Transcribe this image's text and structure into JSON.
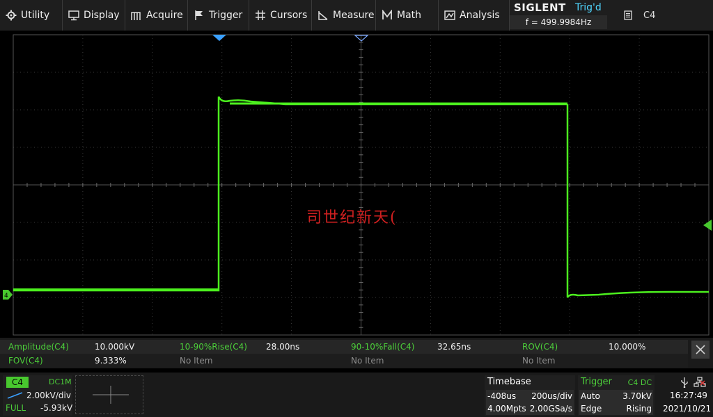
{
  "menu": {
    "utility": "Utility",
    "display": "Display",
    "acquire": "Acquire",
    "trigger": "Trigger",
    "cursors": "Cursors",
    "measure": "Measure",
    "math": "Math",
    "analysis": "Analysis"
  },
  "header": {
    "brand": "SIGLENT",
    "trig_state": "Trig'd",
    "frequency": "f = 499.9984Hz",
    "channel_select": "C4"
  },
  "watermark": "司世纪新天(",
  "measurements": {
    "row1": [
      {
        "label": "Amplitude(C4)",
        "value": "10.000kV"
      },
      {
        "label": "10-90%Rise(C4)",
        "value": "28.00ns"
      },
      {
        "label": "90-10%Fall(C4)",
        "value": "32.65ns"
      },
      {
        "label": "ROV(C4)",
        "value": "10.000%"
      }
    ],
    "row2": [
      {
        "label": "FOV(C4)",
        "value": "9.333%"
      },
      {
        "label": "No Item",
        "value": ""
      },
      {
        "label": "No Item",
        "value": ""
      },
      {
        "label": "No Item",
        "value": ""
      }
    ]
  },
  "channel": {
    "name": "C4",
    "coupling": "DC1M",
    "scale": "2.00kV/div",
    "bandwidth": "FULL",
    "offset": "-5.93kV",
    "color": "#48c82e"
  },
  "timebase": {
    "title": "Timebase",
    "delay": "-408us",
    "scale": "200us/div",
    "memory": "4.00Mpts",
    "sample_rate": "2.00GSa/s"
  },
  "trigger": {
    "title": "Trigger",
    "source": "C4 DC",
    "mode": "Auto",
    "level": "3.70kV",
    "type": "Edge",
    "slope": "Rising"
  },
  "clock": {
    "time": "16:27:49",
    "date": "2021/10/21"
  },
  "colors": {
    "trace": "#4cf01e",
    "accent_blue": "#3aa0ff",
    "label_green": "#4ccf3a"
  }
}
